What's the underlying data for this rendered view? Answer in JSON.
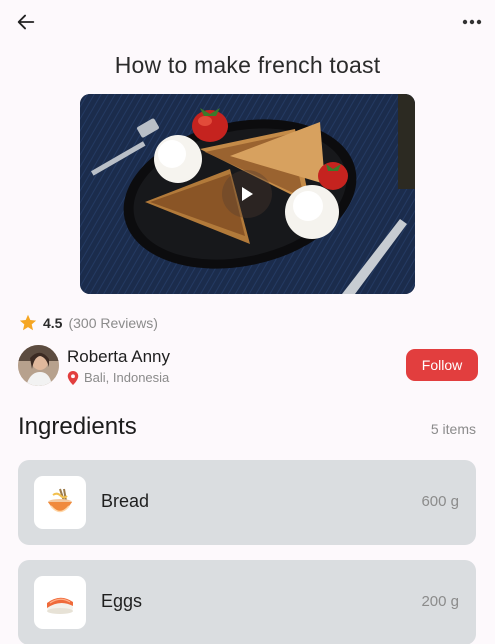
{
  "header": {
    "title": "How to make french toast",
    "back_icon": "arrow-left-icon",
    "more_icon": "more-horizontal-icon"
  },
  "media": {
    "play_icon": "play-icon"
  },
  "rating": {
    "value": "4.5",
    "reviews": "(300 Reviews)",
    "star_color": "#f5a623"
  },
  "author": {
    "name": "Roberta Anny",
    "location": "Bali, Indonesia",
    "follow_label": "Follow",
    "accent": "#e23e3e"
  },
  "ingredients": {
    "title": "Ingredients",
    "count": "5 items",
    "items": [
      {
        "name": "Bread",
        "qty": "600 g",
        "icon": "noodle-bowl-icon"
      },
      {
        "name": "Eggs",
        "qty": "200 g",
        "icon": "sushi-icon"
      }
    ]
  }
}
